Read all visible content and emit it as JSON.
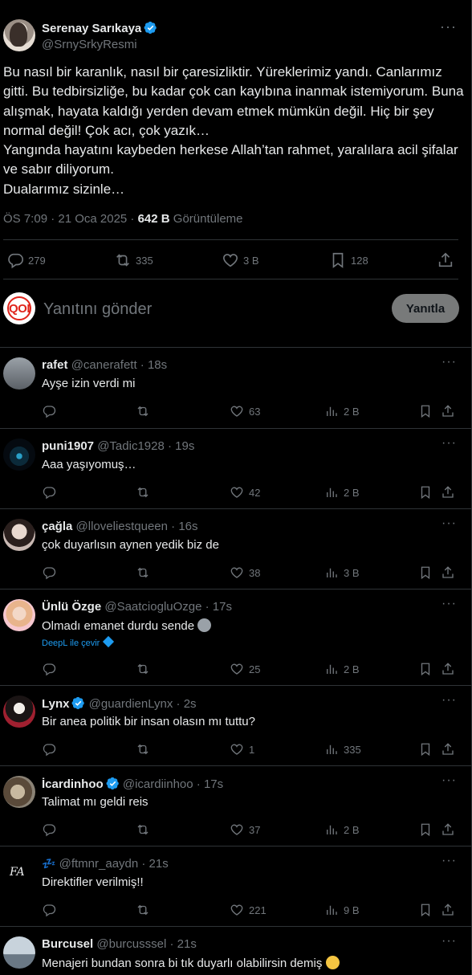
{
  "main_tweet": {
    "author_name": "Serenay Sarıkaya",
    "author_handle": "@SrnySrkyResmi",
    "text_lines": [
      "Bu nasıl bir karanlık, nasıl bir çaresizliktir. Yüreklerimiz yandı. Canlarımız gitti. Bu tedbirsizliğe, bu kadar çok can kayıbına inanmak istemiyorum. Buna alışmak, hayata kaldığı yerden devam etmek mümkün değil. Hiç bir şey normal değil! Çok acı, çok yazık…",
      "Yangında hayatını kaybeden herkese Allah’tan rahmet, yaralılara acil şifalar ve sabır diliyorum.",
      "Dualarımız sizinle…"
    ],
    "timestamp": "ÖS 7:09 · 21 Oca 2025 · ",
    "views_count": "642 B",
    "views_label": " Görüntüleme",
    "replies": "279",
    "retweets": "335",
    "likes": "3 B",
    "bookmarks": "128"
  },
  "reply_box": {
    "avatar_logo": "QOI",
    "placeholder": "Yanıtını gönder",
    "button_label": "Yanıtla"
  },
  "replies": [
    {
      "name": "rafet",
      "handle": "@canerafett · 18s",
      "text": "Ayşe izin verdi mi",
      "replies": "",
      "retweets": "",
      "likes": "63",
      "views": "2 B",
      "verified": false
    },
    {
      "name": "puni1907",
      "handle": "@Tadic1928 · 19s",
      "text": "Aaa yaşıyomuş…",
      "replies": "",
      "retweets": "",
      "likes": "42",
      "views": "2 B",
      "verified": false
    },
    {
      "name": "çağla",
      "handle": "@lloveliestqueen · 16s",
      "text": "çok duyarlısın aynen yedik biz de",
      "replies": "",
      "retweets": "",
      "likes": "38",
      "views": "3 B",
      "verified": false
    },
    {
      "name": "Ünlü Özge",
      "handle": "@SaatciogluOzge · 17s",
      "text": "Olmadı emanet durdu sende",
      "translate": "DeepL ile çevir",
      "replies": "",
      "retweets": "",
      "likes": "25",
      "views": "2 B",
      "verified": false
    },
    {
      "name": "Lynx",
      "handle": "@guardienLynx · 2s",
      "text": "Bir anea politik bir insan olasın mı tuttu?",
      "replies": "",
      "retweets": "",
      "likes": "1",
      "views": "335",
      "verified": true
    },
    {
      "name": "İcardinhoo",
      "handle": "@icardiinhoo · 17s",
      "text": "Talimat mı geldi reis",
      "replies": "",
      "retweets": "",
      "likes": "37",
      "views": "2 B",
      "verified": true
    },
    {
      "name": "",
      "handle": "@ftmnr_aaydn · 21s",
      "text": "Direktifler verilmiş!!",
      "avatar_logo": "FA",
      "replies": "",
      "retweets": "",
      "likes": "221",
      "views": "9 B",
      "verified": false
    },
    {
      "name": "Burcusel",
      "handle": "@burcusssel · 21s",
      "text": "Menajeri bundan sonra bi tık duyarlı olabilirsin demiş",
      "replies": "",
      "retweets": "",
      "likes": "",
      "views": "",
      "verified": false
    }
  ],
  "colors": {
    "background": "#000000",
    "text": "#e7e9ea",
    "muted": "#71767b",
    "border": "#2f3336",
    "verified": "#1d9bf0",
    "brand_red": "#e0241b"
  }
}
